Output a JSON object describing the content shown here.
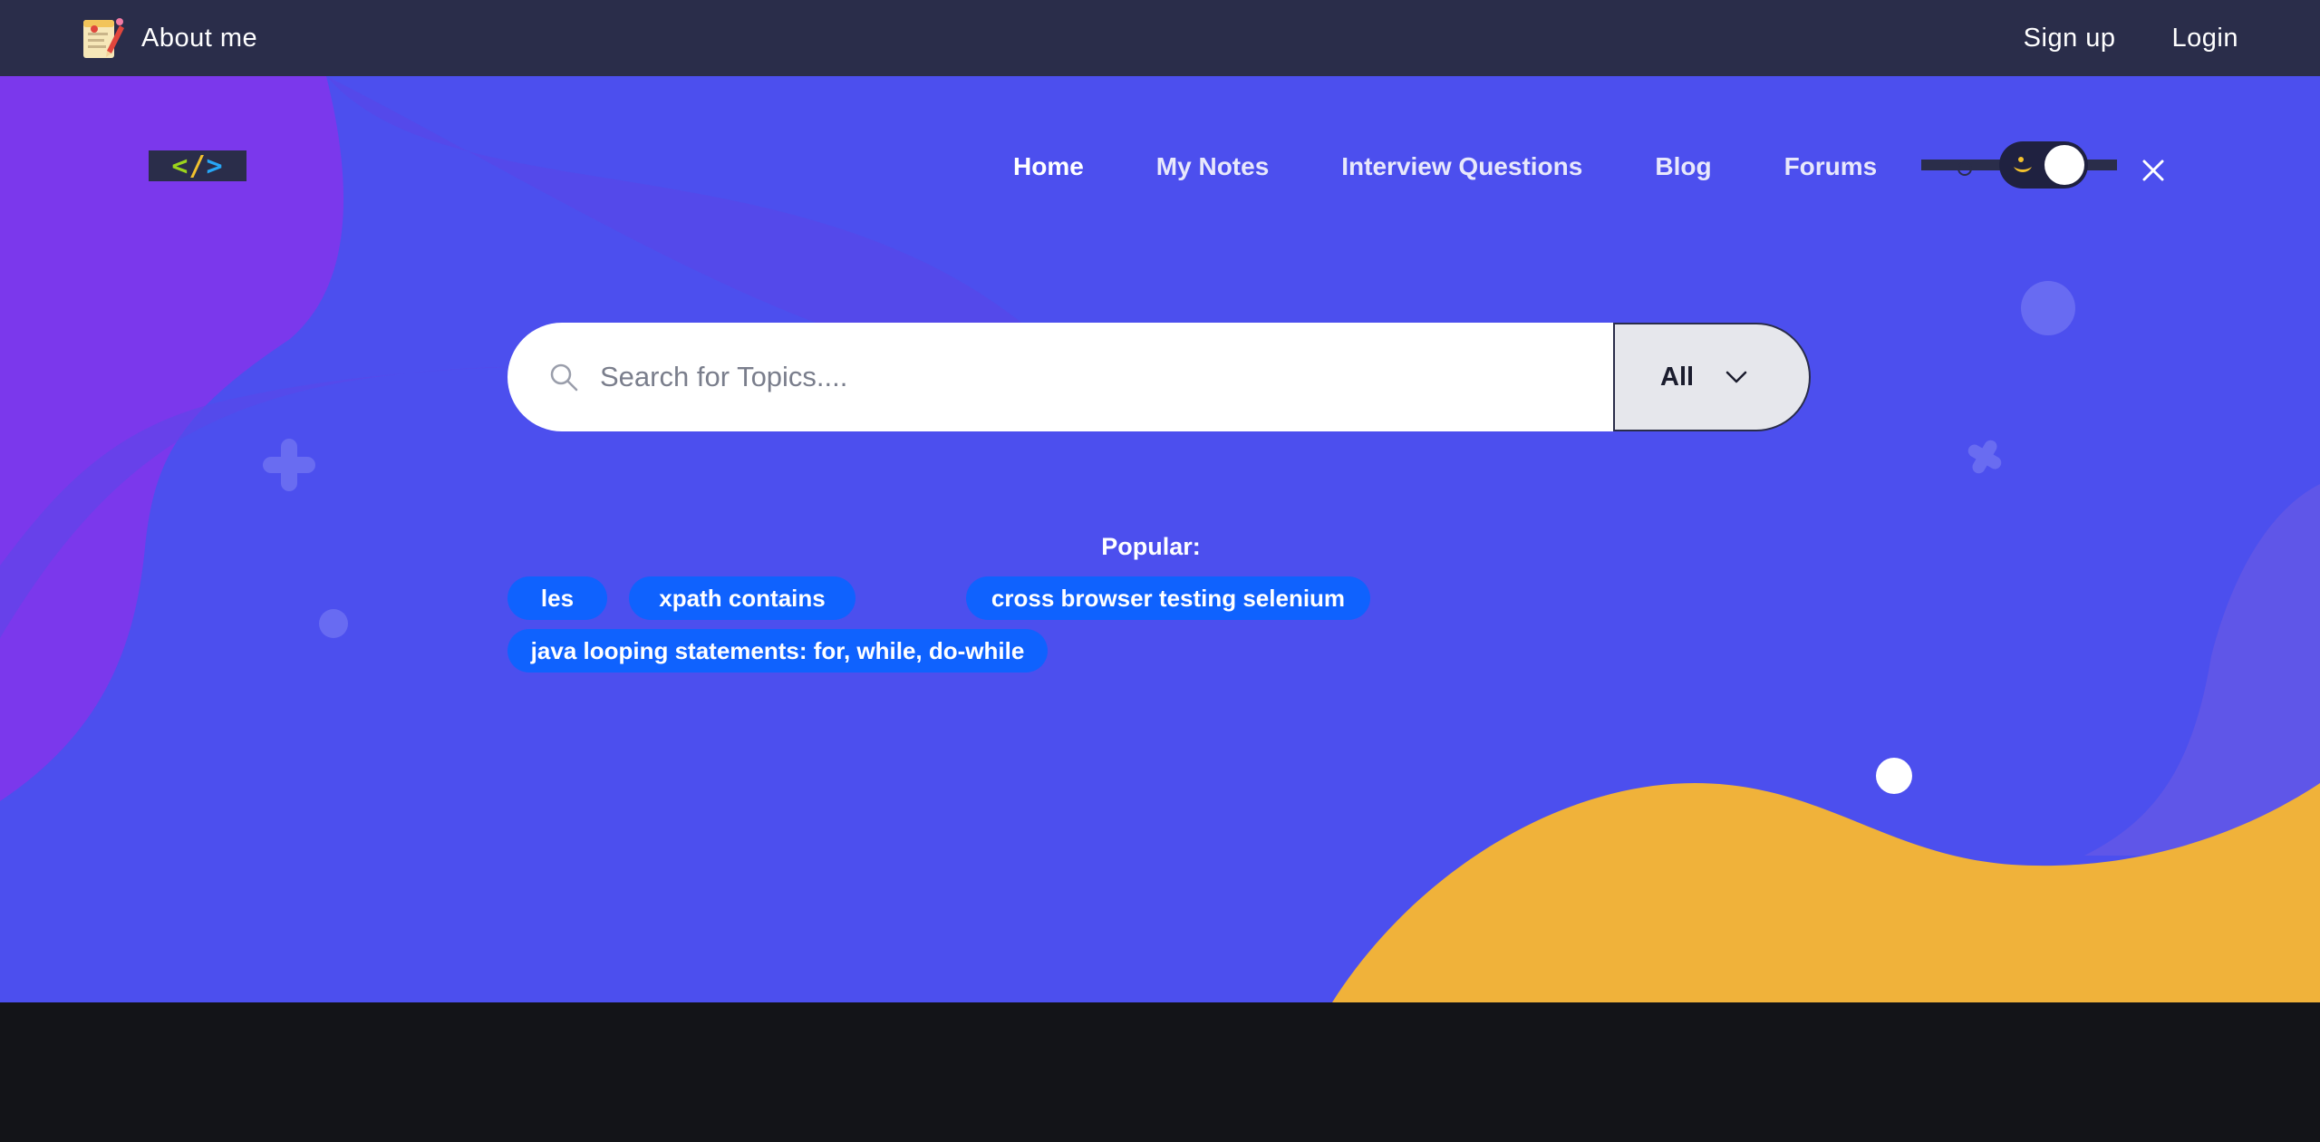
{
  "topbar": {
    "about_label": "About me",
    "signup_label": "Sign up",
    "login_label": "Login"
  },
  "logo": {
    "lt": "<",
    "slash": "/",
    "gt": ">"
  },
  "nav": {
    "items": [
      {
        "label": "Home",
        "active": true
      },
      {
        "label": "My Notes"
      },
      {
        "label": "Interview Questions"
      },
      {
        "label": "Blog"
      },
      {
        "label": "Forums"
      }
    ]
  },
  "search": {
    "placeholder": "Search for Topics....",
    "value": "",
    "category": "All"
  },
  "popular": {
    "label": "Popular:",
    "chips": [
      "les",
      "xpath contains",
      "cross browser testing selenium",
      "java looping statements: for, while, do-while"
    ]
  },
  "icons": {
    "about": "notepad-pencil-icon",
    "search": "search-icon",
    "dropdown": "chevron-down-icon",
    "theme_toggle": "moon-icon",
    "close": "close-icon"
  },
  "colors": {
    "topbar": "#2a2d4a",
    "hero": "#4c4fee",
    "purple_blob": "#7b38ec",
    "orange_wave": "#f0b23a",
    "chip": "#0f62fe",
    "footer": "#131418"
  }
}
